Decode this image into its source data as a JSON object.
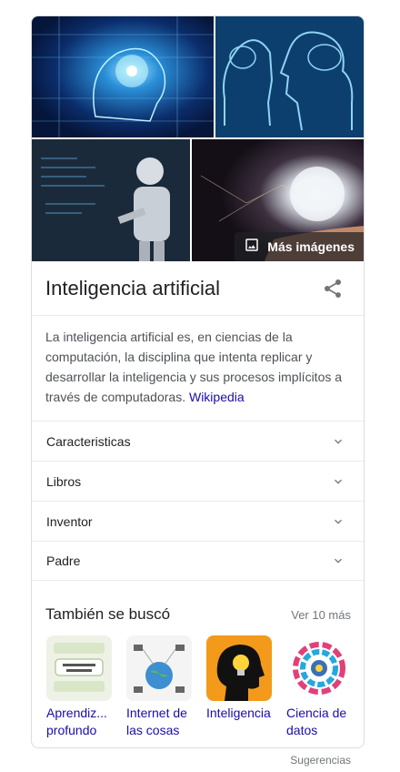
{
  "panel": {
    "title": "Inteligencia artificial",
    "more_images_label": "Más imágenes",
    "description": "La inteligencia artificial es, en ciencias de la computación, la disciplina que intenta replicar y desarrollar la inteligencia y sus procesos implícitos a través de computadoras.",
    "source_link": "Wikipedia"
  },
  "accordion": [
    {
      "label": "Caracteristicas"
    },
    {
      "label": "Libros"
    },
    {
      "label": "Inventor"
    },
    {
      "label": "Padre"
    }
  ],
  "related": {
    "title": "También se buscó",
    "see_more": "Ver 10 más",
    "items": [
      {
        "label": "Aprendiz... profundo"
      },
      {
        "label": "Internet de las cosas"
      },
      {
        "label": "Inteligencia"
      },
      {
        "label": "Ciencia de datos"
      }
    ]
  },
  "footer": {
    "suggestions": "Sugerencias"
  },
  "colors": {
    "link": "#1a0dab",
    "muted": "#70757a",
    "text": "#202124"
  }
}
